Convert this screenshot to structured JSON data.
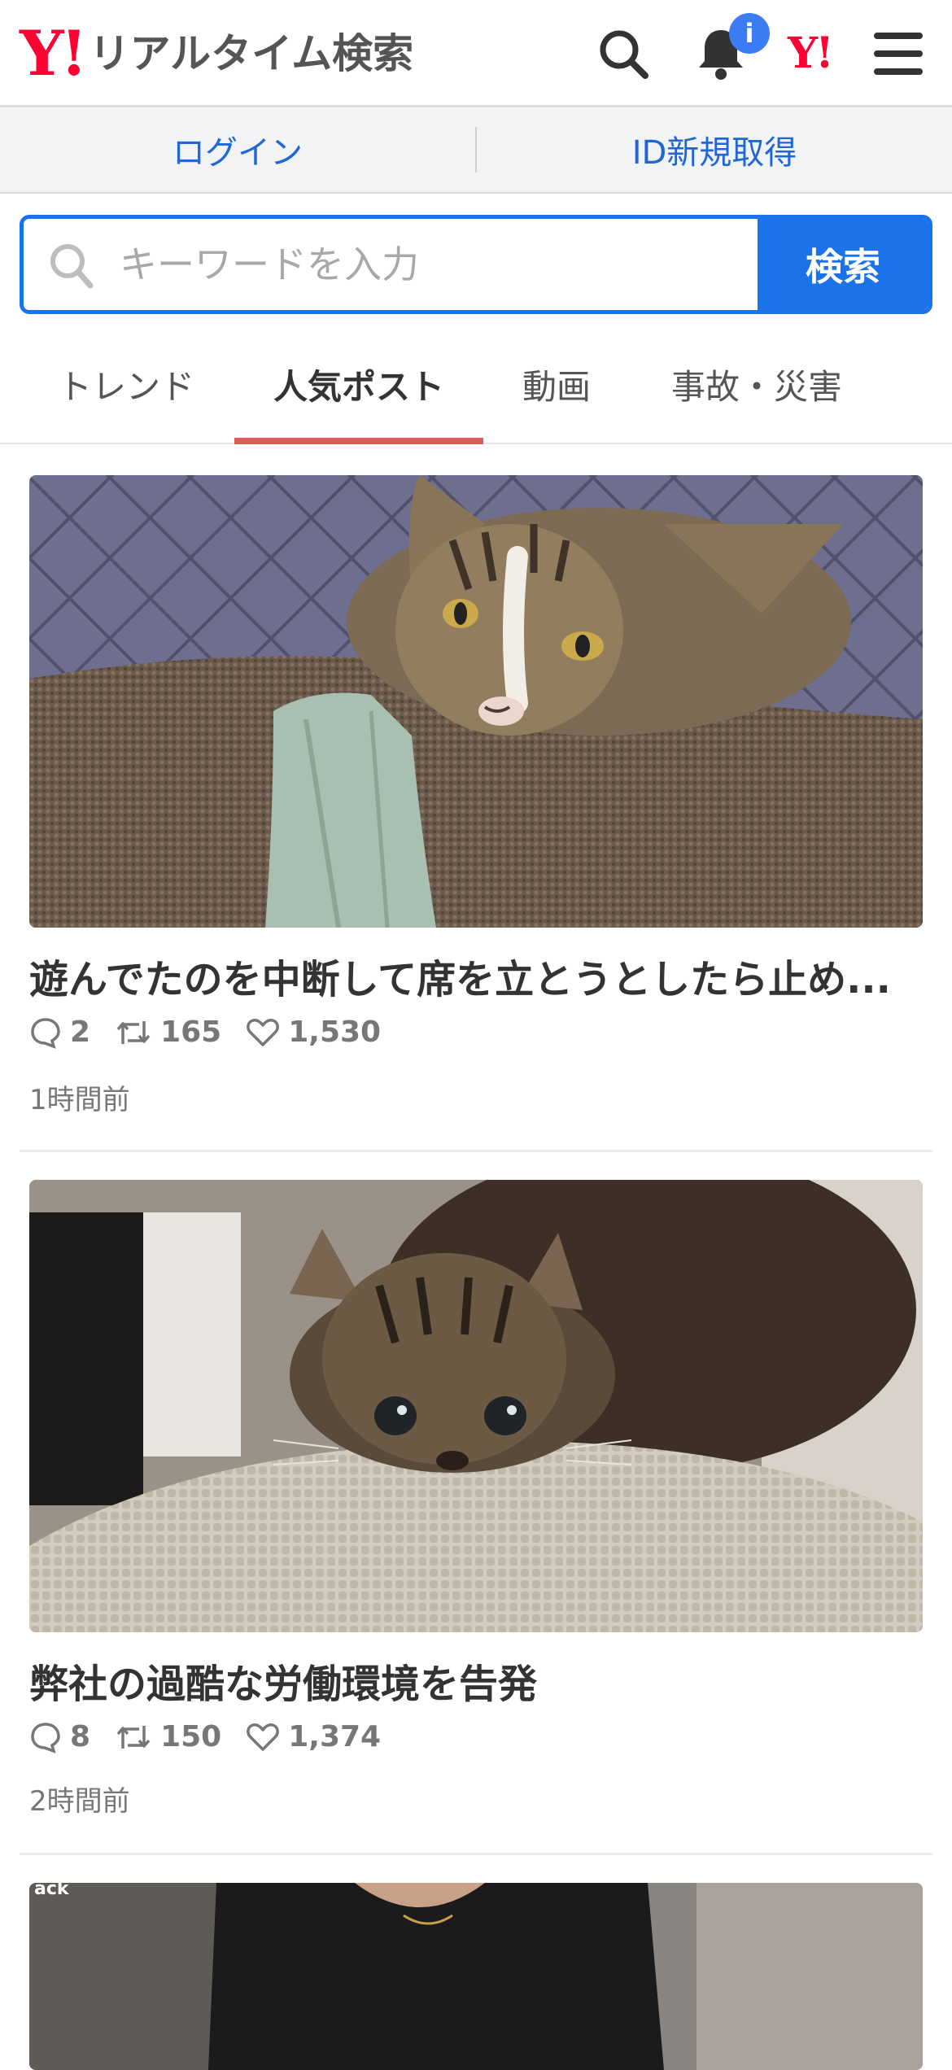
{
  "header": {
    "logo_mark": "Y!",
    "logo_text": "リアルタイム検索",
    "notification_badge": "i",
    "yahoo_mark": "Y!"
  },
  "account": {
    "login": "ログイン",
    "register": "ID新規取得"
  },
  "search": {
    "placeholder": "キーワードを入力",
    "value": "",
    "button": "検索"
  },
  "tabs": [
    {
      "label": "トレンド",
      "active": false
    },
    {
      "label": "人気ポスト",
      "active": true
    },
    {
      "label": "動画",
      "active": false
    },
    {
      "label": "事故・災害",
      "active": false
    }
  ],
  "posts": [
    {
      "title": "遊んでたのを中断して席を立とうとしたら止め...",
      "replies": "2",
      "reposts": "165",
      "likes": "1,530",
      "time": "1時間前"
    },
    {
      "title": "弊社の過酷な労働環境を告発",
      "replies": "8",
      "reposts": "150",
      "likes": "1,374",
      "time": "2時間前"
    },
    {
      "image_caption": "ack"
    }
  ],
  "colors": {
    "brand_red": "#ff0033",
    "accent_blue": "#1a73e8",
    "tab_indicator": "#e05a5a"
  }
}
